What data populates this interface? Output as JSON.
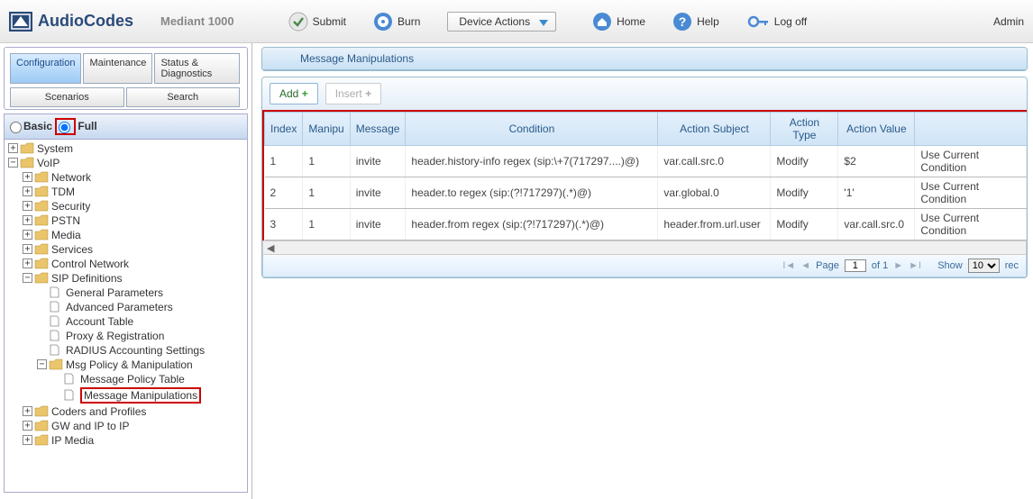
{
  "brand": "AudioCodes",
  "model": "Mediant 1000",
  "top": {
    "submit": "Submit",
    "burn": "Burn",
    "device_actions": "Device Actions",
    "home": "Home",
    "help": "Help",
    "logoff": "Log off",
    "admin": "Admin"
  },
  "tabs": {
    "configuration": "Configuration",
    "maintenance": "Maintenance",
    "status": "Status & Diagnostics",
    "scenarios": "Scenarios",
    "search": "Search"
  },
  "viewmode": {
    "basic": "Basic",
    "full": "Full"
  },
  "tree": {
    "system": "System",
    "voip": "VoIP",
    "network": "Network",
    "tdm": "TDM",
    "security": "Security",
    "pstn": "PSTN",
    "media": "Media",
    "services": "Services",
    "control_network": "Control Network",
    "sip_definitions": "SIP Definitions",
    "general_parameters": "General Parameters",
    "advanced_parameters": "Advanced Parameters",
    "account_table": "Account Table",
    "proxy_registration": "Proxy & Registration",
    "radius": "RADIUS Accounting Settings",
    "msg_policy": "Msg Policy & Manipulation",
    "msg_policy_table": "Message Policy Table",
    "msg_manipulations": "Message Manipulations",
    "coders": "Coders and Profiles",
    "gw_ip": "GW and IP to IP",
    "ip_media": "IP Media"
  },
  "panel": {
    "title": "Message Manipulations",
    "add": "Add",
    "insert": "Insert"
  },
  "columns": {
    "index": "Index",
    "manip": "Manipu",
    "msgtype": "Message",
    "condition": "Condition",
    "subject": "Action Subject",
    "actiontype": "Action Type",
    "actionvalue": "Action Value",
    "rowrole": ""
  },
  "rows": [
    {
      "index": "1",
      "manip": "1",
      "msgtype": "invite",
      "condition": "header.history-info regex (sip:\\+7(717297....)@)",
      "subject": "var.call.src.0",
      "actiontype": "Modify",
      "actionvalue": "$2",
      "rowrole": "Use Current Condition"
    },
    {
      "index": "2",
      "manip": "1",
      "msgtype": "invite",
      "condition": "header.to regex (sip:(?!717297)(.*)@)",
      "subject": "var.global.0",
      "actiontype": "Modify",
      "actionvalue": "'1'",
      "rowrole": "Use Current Condition"
    },
    {
      "index": "3",
      "manip": "1",
      "msgtype": "invite",
      "condition": "header.from regex (sip:(?!717297)(.*)@)",
      "subject": "header.from.url.user",
      "actiontype": "Modify",
      "actionvalue": "var.call.src.0",
      "rowrole": "Use Current Condition"
    }
  ],
  "pager": {
    "page_label": "Page",
    "page_val": "1",
    "of": "of 1",
    "show": "Show",
    "show_val": "10",
    "rec": "rec"
  }
}
